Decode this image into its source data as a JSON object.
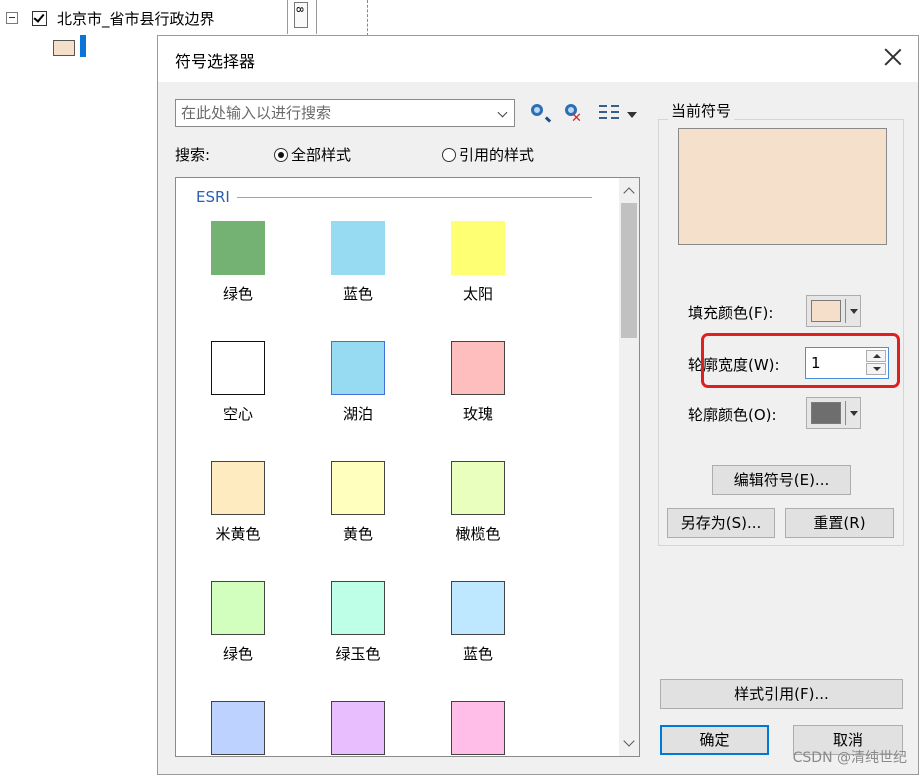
{
  "toc": {
    "layer_label": "北京市_省市县行政边界",
    "swatch_color": "#f5deca",
    "marker_color": "#0a74d9"
  },
  "dialog": {
    "title": "符号选择器",
    "search_placeholder": "在此处输入以进行搜索",
    "search_label": "搜索:",
    "radio_all": "全部样式",
    "radio_referenced": "引用的样式",
    "selected_radio": "全部样式",
    "group_title": "ESRI",
    "symbols": [
      {
        "label": "绿色",
        "color": "#73b273",
        "border": "none"
      },
      {
        "label": "蓝色",
        "color": "#97dbf2",
        "border": "none"
      },
      {
        "label": "太阳",
        "color": "#ffff73",
        "border": "none"
      },
      {
        "label": "空心",
        "color": "#ffffff",
        "border": "#111111"
      },
      {
        "label": "湖泊",
        "color": "#97dbf2",
        "border": "#4170d9"
      },
      {
        "label": "玫瑰",
        "color": "#ffbebe",
        "border": "#444444"
      },
      {
        "label": "米黄色",
        "color": "#ffebc0",
        "border": "#444444"
      },
      {
        "label": "黄色",
        "color": "#ffffbe",
        "border": "#444444"
      },
      {
        "label": "橄榄色",
        "color": "#e9ffbe",
        "border": "#444444"
      },
      {
        "label": "绿色",
        "color": "#d3ffbe",
        "border": "#444444"
      },
      {
        "label": "绿玉色",
        "color": "#beffe8",
        "border": "#444444"
      },
      {
        "label": "蓝色",
        "color": "#bee8ff",
        "border": "#444444"
      },
      {
        "label": "",
        "color": "#bed2ff",
        "border": "#444444"
      },
      {
        "label": "",
        "color": "#e8beff",
        "border": "#444444"
      },
      {
        "label": "",
        "color": "#ffbee8",
        "border": "#444444"
      }
    ],
    "current_symbol": {
      "legend": "当前符号",
      "preview_color": "#f5e0cb",
      "fill_color_label": "填充颜色(F):",
      "fill_color": "#f5deca",
      "outline_width_label": "轮廓宽度(W):",
      "outline_width_value": "1",
      "outline_color_label": "轮廓颜色(O):",
      "outline_color": "#6e6e6e",
      "edit_symbol_button": "编辑符号(E)...",
      "save_as_button": "另存为(S)...",
      "reset_button": "重置(R)"
    },
    "style_references_button": "样式引用(F)...",
    "ok_button": "确定",
    "cancel_button": "取消"
  },
  "watermark": "CSDN @清纯世纪"
}
